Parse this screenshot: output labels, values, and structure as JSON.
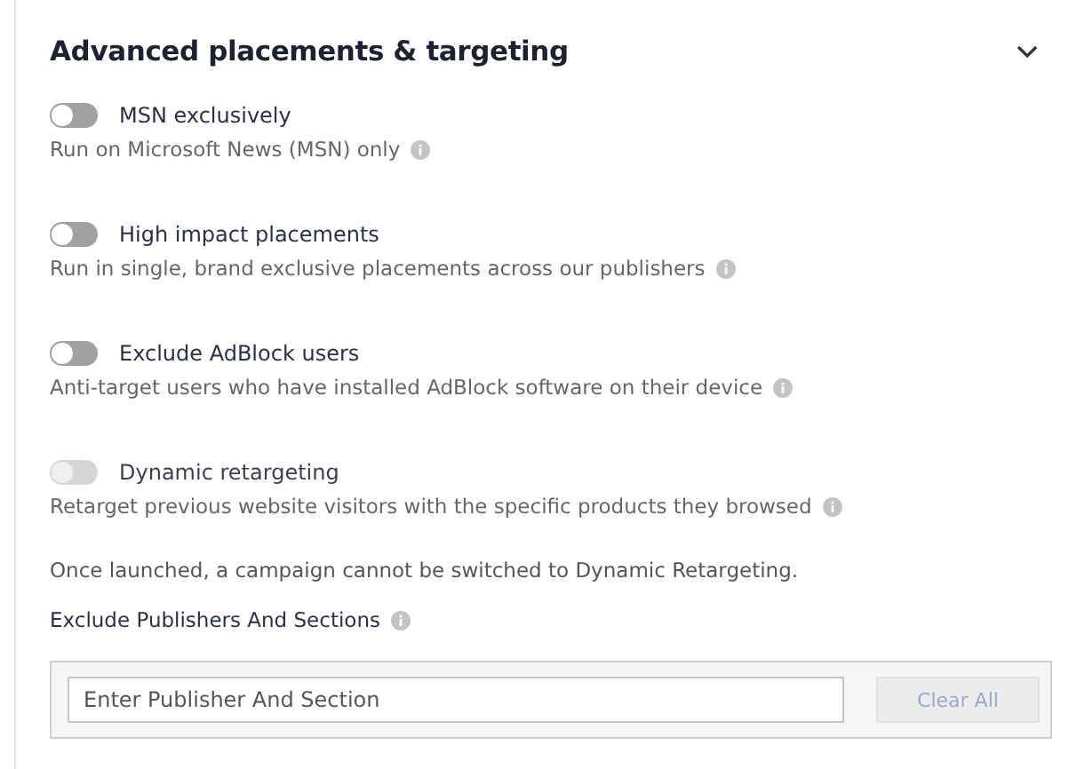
{
  "section": {
    "title": "Advanced placements & targeting",
    "expanded": true
  },
  "options": [
    {
      "label": "MSN exclusively",
      "description": "Run on Microsoft News (MSN) only",
      "on": false,
      "disabled": false
    },
    {
      "label": "High impact placements",
      "description": "Run in single, brand exclusive placements across our publishers",
      "on": false,
      "disabled": false
    },
    {
      "label": "Exclude AdBlock users",
      "description": "Anti-target users who have installed AdBlock software on their device",
      "on": false,
      "disabled": false
    },
    {
      "label": "Dynamic retargeting",
      "description": "Retarget previous website visitors with the specific products they browsed",
      "on": false,
      "disabled": true
    }
  ],
  "notice": "Once launched, a campaign cannot be switched to Dynamic Retargeting.",
  "exclude": {
    "label": "Exclude Publishers And Sections",
    "placeholder": "Enter Publisher And Section",
    "clear_button": {
      "label": "Clear All",
      "disabled": true
    }
  }
}
